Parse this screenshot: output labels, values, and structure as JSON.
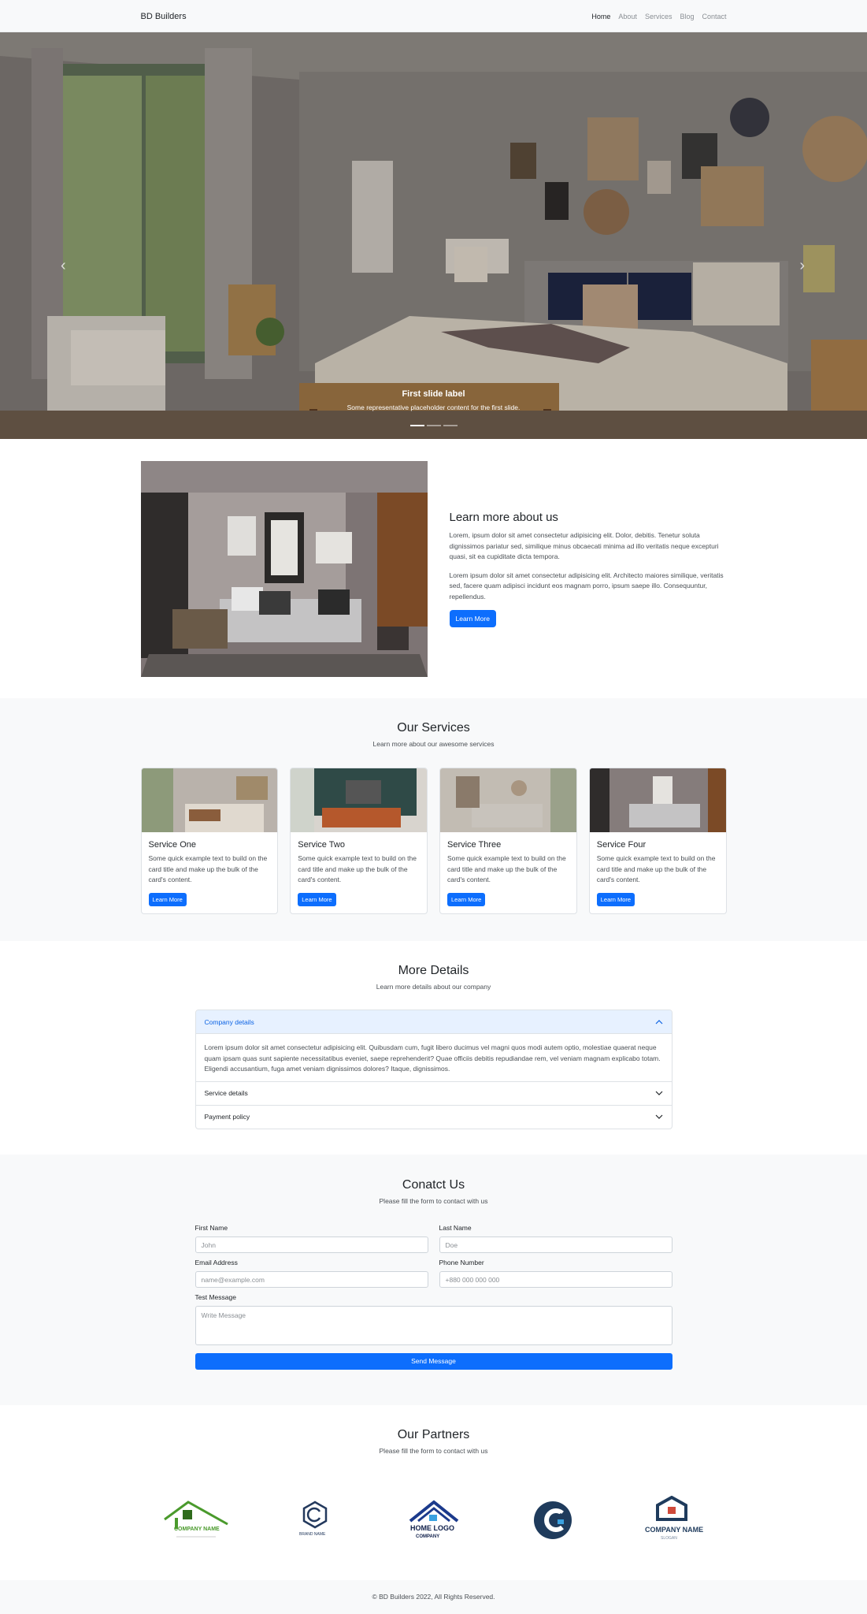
{
  "nav": {
    "brand": "BD Builders",
    "links": [
      "Home",
      "About",
      "Services",
      "Blog",
      "Contact"
    ]
  },
  "hero": {
    "caption_title": "First slide label",
    "caption_text": "Some representative placeholder content for the first slide.",
    "prev_icon": "‹",
    "next_icon": "›",
    "slide_count": 3,
    "active_slide": 1
  },
  "about": {
    "title": "Learn more about us",
    "paragraph1": "Lorem, ipsum dolor sit amet consectetur adipisicing elit. Dolor, debitis. Tenetur soluta dignissimos pariatur sed, similique minus obcaecati minima ad illo veritatis neque excepturi quasi, sit ea cupiditate dicta tempora.",
    "paragraph2": "Lorem ipsum dolor sit amet consectetur adipisicing elit. Architecto maiores similique, veritatis sed, facere quam adipisci incidunt eos magnam porro, ipsum saepe illo. Consequuntur, repellendus.",
    "button": "Learn More"
  },
  "services": {
    "title": "Our Services",
    "subtitle": "Learn more about our awesome services",
    "cards": [
      {
        "title": "Service One",
        "text": "Some quick example text to build on the card title and make up the bulk of the card's content.",
        "button": "Learn More"
      },
      {
        "title": "Service Two",
        "text": "Some quick example text to build on the card title and make up the bulk of the card's content.",
        "button": "Learn More"
      },
      {
        "title": "Service Three",
        "text": "Some quick example text to build on the card title and make up the bulk of the card's content.",
        "button": "Learn More"
      },
      {
        "title": "Service Four",
        "text": "Some quick example text to build on the card title and make up the bulk of the card's content.",
        "button": "Learn More"
      }
    ]
  },
  "details": {
    "title": "More Details",
    "subtitle": "Learn more details about our company",
    "items": [
      {
        "label": "Company details",
        "body": "Lorem ipsum dolor sit amet consectetur adipisicing elit. Quibusdam cum, fugit libero ducimus vel magni quos modi autem optio, molestiae quaerat neque quam ipsam quas sunt sapiente necessitatibus eveniet, saepe reprehenderit? Quae officiis debitis repudiandae rem, vel veniam magnam explicabo totam. Eligendi accusantium, fuga amet veniam dignissimos dolores? Itaque, dignissimos."
      },
      {
        "label": "Service details"
      },
      {
        "label": "Payment policy"
      }
    ]
  },
  "contact": {
    "title": "Conatct Us",
    "subtitle": "Please fill the form to contact with us",
    "first_name_label": "First Name",
    "first_name_placeholder": "John",
    "last_name_label": "Last Name",
    "last_name_placeholder": "Doe",
    "email_label": "Email Address",
    "email_placeholder": "name@example.com",
    "phone_label": "Phone Number",
    "phone_placeholder": "+880 000 000 000",
    "message_label": "Test Message",
    "message_placeholder": "Write Message",
    "send_button": "Send Message"
  },
  "partners": {
    "title": "Our Partners",
    "subtitle": "Please fill the form to contact with us",
    "logos": [
      {
        "icon": "house-roof-logo",
        "text": "COMPANY NAME",
        "color": "#4a9a2c"
      },
      {
        "icon": "hexagon-c-logo",
        "text": "BRAND NAME",
        "color": "#23395d"
      },
      {
        "icon": "house-outline-logo",
        "text": "HOME LOGO",
        "sub": "COMPANY",
        "color": "#1b3a8c"
      },
      {
        "icon": "circle-c-house-logo",
        "color": "#1f3b5c"
      },
      {
        "icon": "hexagon-house-logo",
        "text": "COMPANY NAME",
        "sub": "SLOGAN",
        "color": "#1f3b5c"
      }
    ]
  },
  "footer": {
    "text": "© BD Builders 2022, All Rights Reserved."
  },
  "colors": {
    "primary": "#0d6efd",
    "light_bg": "#f8f9fa",
    "accordion_open_bg": "#e7f1ff"
  }
}
